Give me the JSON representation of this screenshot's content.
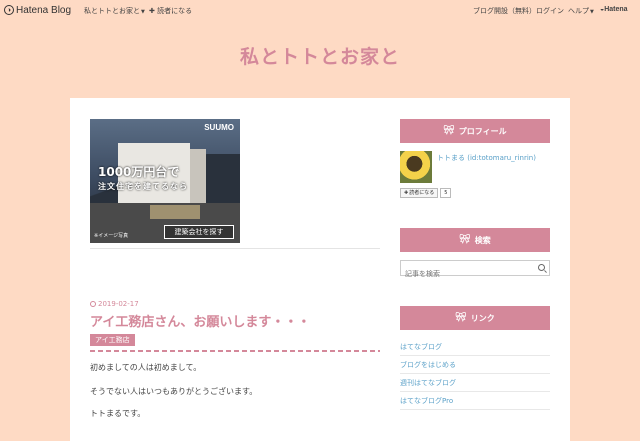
{
  "topbar": {
    "logo_text": "Hatena Blog",
    "blog_menu": "私とトトとお家と",
    "subscribe": "✚ 読者になる",
    "right": {
      "start_blog": "ブログ開設（無料）",
      "login": "ログイン",
      "help": "ヘルプ",
      "hatena": "Hatena"
    }
  },
  "blog": {
    "title": "私とトトとお家と"
  },
  "ad": {
    "brand": "SUUMO",
    "headline": "1000万円台で",
    "subline": "注文住宅を建てるなら",
    "note": "※イメージ写真",
    "cta": "建築会社を探す"
  },
  "entry": {
    "date": "2019-02-17",
    "title": "アイ工務店さん、お願いします・・・",
    "category": "アイ工務店",
    "paragraphs": [
      "初めましての人は初めまして。",
      "そうでない人はいつもありがとうございます。",
      "トトまるです。"
    ]
  },
  "sidebar": {
    "profile": {
      "heading": "プロフィール",
      "name": "トトまる (id:totomaru_rinrin)",
      "follow_label": "読者になる",
      "follow_count": "5"
    },
    "search": {
      "heading": "検索",
      "placeholder": "記事を検索"
    },
    "links": {
      "heading": "リンク",
      "items": [
        "はてなブログ",
        "ブログをはじめる",
        "週刊はてなブログ",
        "はてなブログPro"
      ]
    }
  },
  "colors": {
    "background": "#fedac4",
    "accent": "#d4889a",
    "link": "#5aa0c8"
  }
}
